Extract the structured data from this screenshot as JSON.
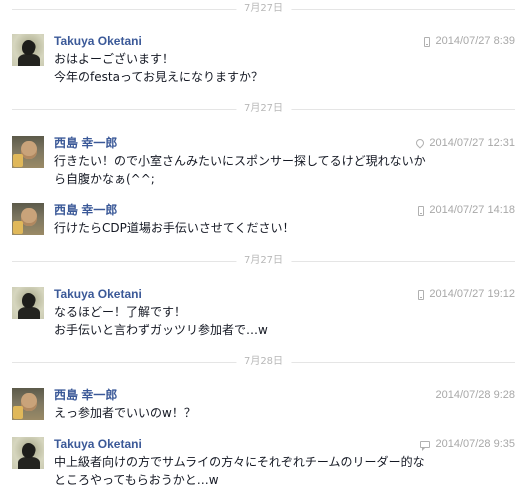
{
  "separators": [
    {
      "label": "7月27日"
    },
    {
      "label": "7月27日"
    },
    {
      "label": "7月27日"
    },
    {
      "label": "7月28日"
    }
  ],
  "messages": [
    {
      "sender": "Takuya Oketani",
      "avatar": "oketani-avatar",
      "source_icon": "mobile-icon",
      "time": "2014/07/27 8:39",
      "lines": [
        "おはよーございます！",
        "今年のfestaってお見えになりますか？"
      ]
    },
    {
      "sender": "西島 幸一郎",
      "avatar": "nishijima-avatar",
      "source_icon": "location-icon",
      "time": "2014/07/27 12:31",
      "lines": [
        "行きたい！ので小室さんみたいにスポンサー探してるけど現れないか",
        "ら自腹かなぁ(^^;"
      ]
    },
    {
      "sender": "西島 幸一郎",
      "avatar": "nishijima-avatar",
      "source_icon": "mobile-icon",
      "time": "2014/07/27 14:18",
      "lines": [
        "行けたらCDP道場お手伝いさせてください！"
      ]
    },
    {
      "sender": "Takuya Oketani",
      "avatar": "oketani-avatar",
      "source_icon": "mobile-icon",
      "time": "2014/07/27 19:12",
      "lines": [
        "なるほどー！了解です！",
        "お手伝いと言わずガッツリ参加者で…w"
      ]
    },
    {
      "sender": "西島 幸一郎",
      "avatar": "nishijima-avatar",
      "source_icon": "",
      "time": "2014/07/28 9:28",
      "lines": [
        "えっ参加者でいいのw！？"
      ]
    },
    {
      "sender": "Takuya Oketani",
      "avatar": "oketani-avatar",
      "source_icon": "chat-icon",
      "time": "2014/07/28 9:35",
      "lines": [
        "中上級者向けの方でサムライの方々にそれぞれチームのリーダー的な",
        "ところやってもらおうかと…w"
      ]
    }
  ]
}
